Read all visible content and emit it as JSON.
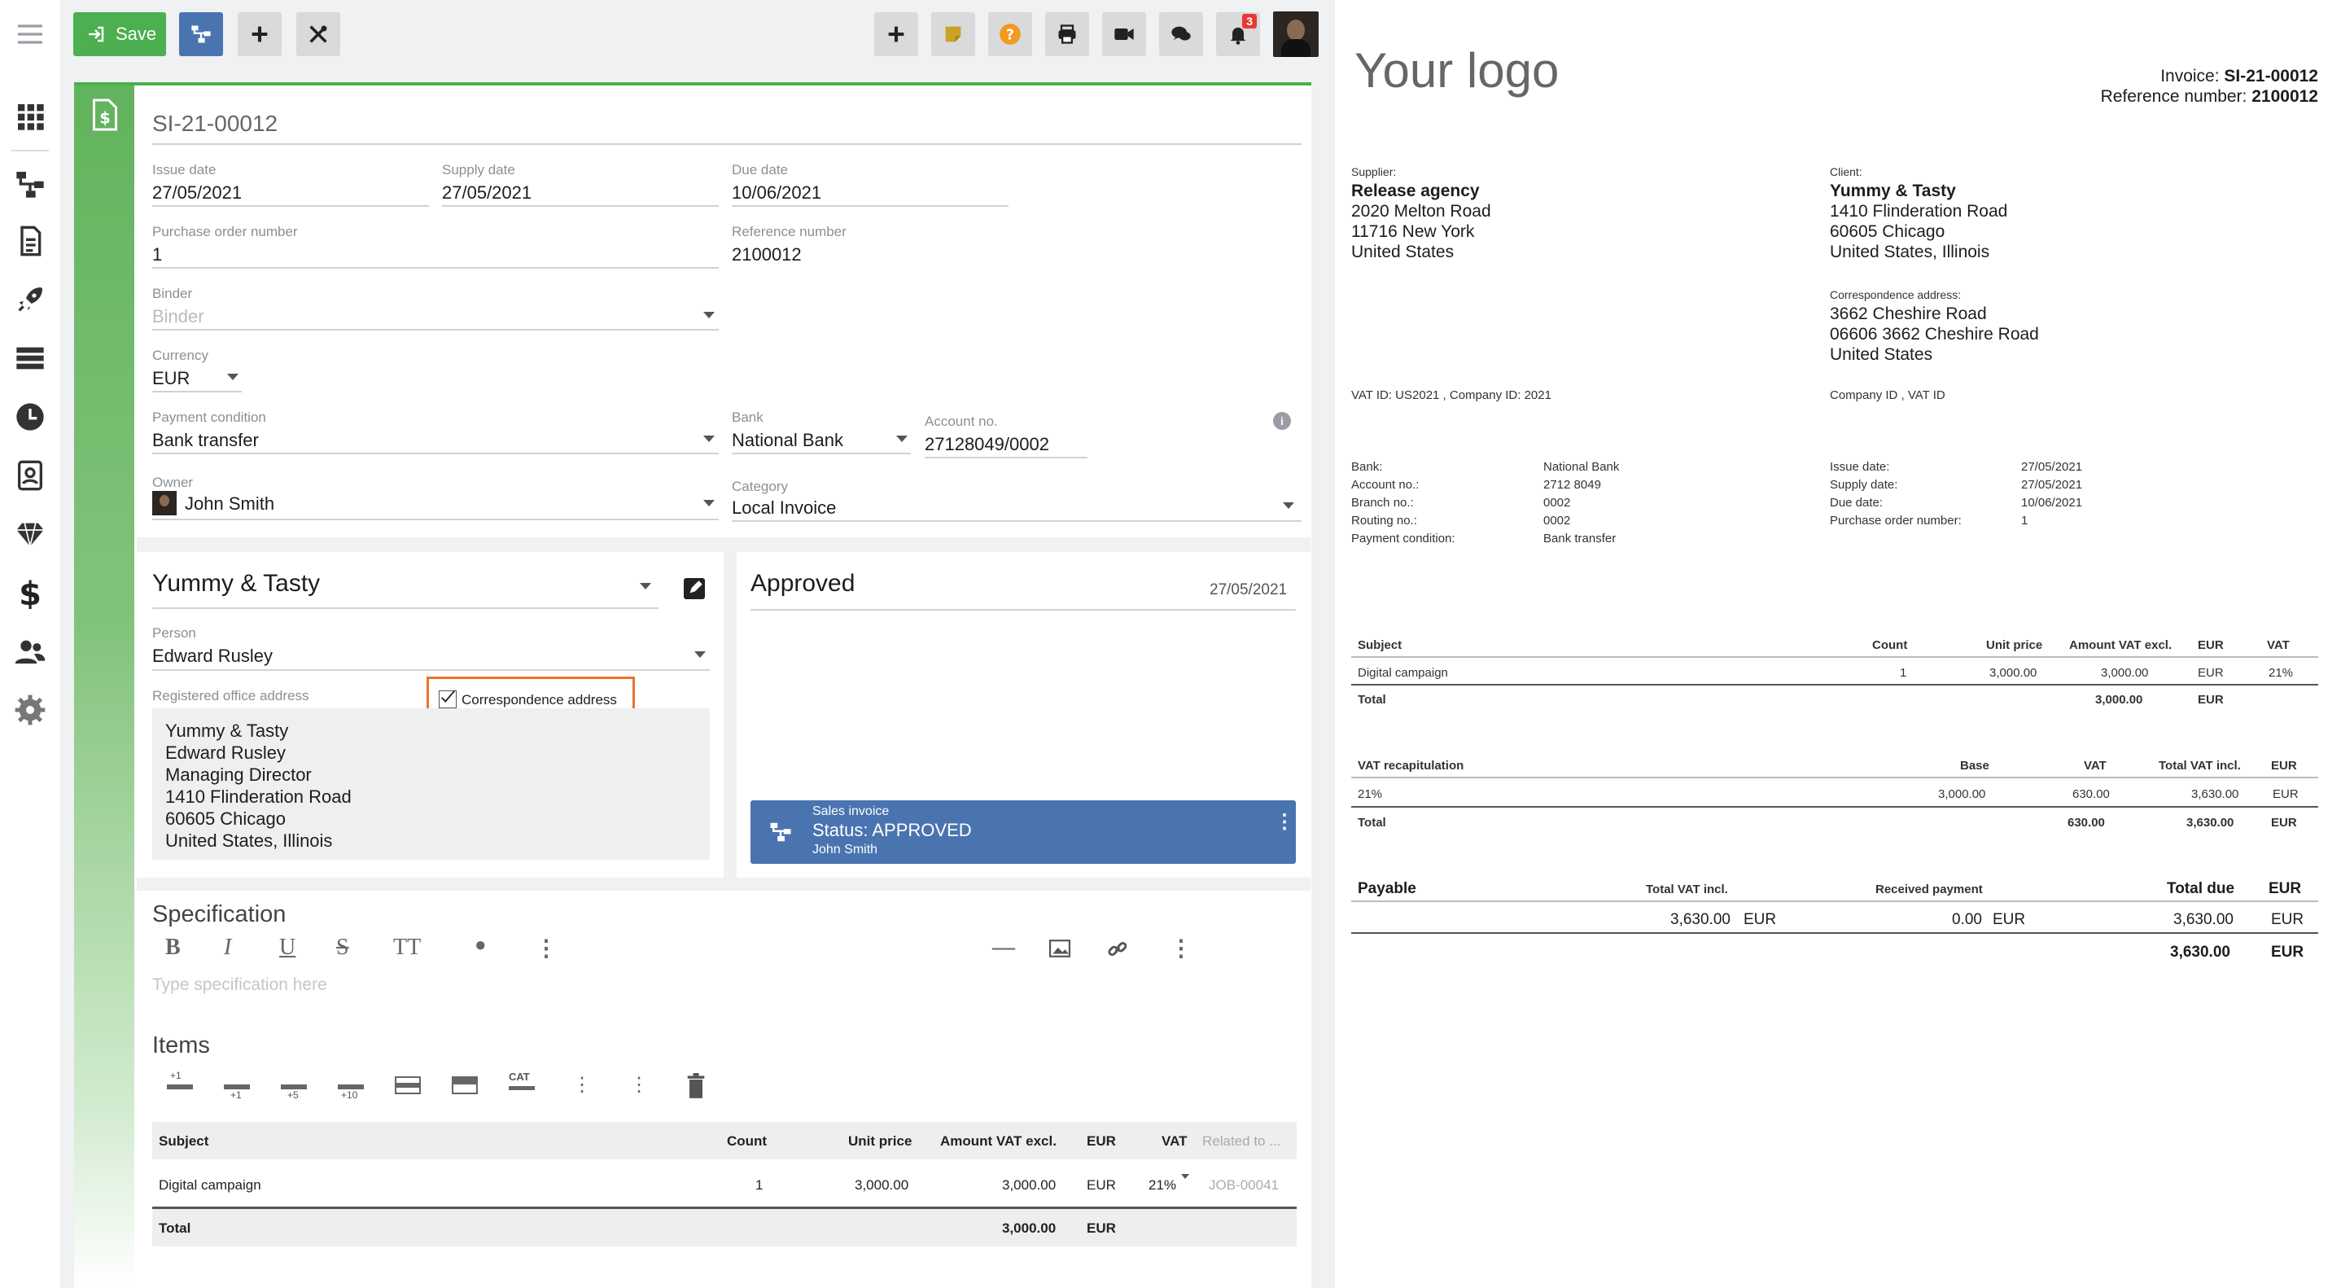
{
  "notifications_count": "3",
  "toolbar": {
    "save_label": "Save"
  },
  "doc": {
    "side_title": "SALES INVOICE",
    "number": "SI-21-00012",
    "issue_date_label": "Issue date",
    "issue_date": "27/05/2021",
    "supply_date_label": "Supply date",
    "supply_date": "27/05/2021",
    "due_date_label": "Due date",
    "due_date": "10/06/2021",
    "po_label": "Purchase order number",
    "po": "1",
    "ref_label": "Reference number",
    "ref": "2100012",
    "binder_label": "Binder",
    "binder_placeholder": "Binder",
    "currency_label": "Currency",
    "currency": "EUR",
    "payment_label": "Payment condition",
    "payment": "Bank transfer",
    "bank_label": "Bank",
    "bank": "National Bank",
    "account_label": "Account no.",
    "account": "27128049/0002",
    "owner_label": "Owner",
    "owner": "John Smith",
    "category_label": "Category",
    "category": "Local Invoice"
  },
  "client": {
    "name": "Yummy & Tasty",
    "person_label": "Person",
    "person": "Edward Rusley",
    "address_label": "Registered office address",
    "correspondence_label": "Correspondence address",
    "address_lines": [
      "Yummy & Tasty",
      "Edward Rusley",
      "Managing Director",
      "1410 Flinderation Road",
      "60605 Chicago",
      "United States, Illinois"
    ]
  },
  "status": {
    "title": "Approved",
    "date": "27/05/2021",
    "card_type": "Sales invoice",
    "card_status": "Status: APPROVED",
    "card_user": "John Smith",
    "card_color": "#4a74b0"
  },
  "spec": {
    "title": "Specification",
    "placeholder": "Type specification here"
  },
  "items": {
    "title": "Items",
    "toolbar_badges": [
      "+1",
      "+1",
      "+5",
      "+10",
      "CAT"
    ],
    "headers": [
      "Subject",
      "Count",
      "Unit price",
      "Amount VAT excl.",
      "EUR",
      "VAT",
      "Related to ..."
    ],
    "row": {
      "subject": "Digital campaign",
      "count": "1",
      "unit_price": "3,000.00",
      "amount": "3,000.00",
      "cur": "EUR",
      "vat": "21%",
      "related": "JOB-00041"
    },
    "total": {
      "label": "Total",
      "amount": "3,000.00",
      "cur": "EUR"
    }
  },
  "preview": {
    "logo": "Your logo",
    "invoice_label": "Invoice:",
    "invoice_no": "SI-21-00012",
    "ref_label": "Reference number:",
    "ref_no": "2100012",
    "supplier_label": "Supplier:",
    "supplier_name": "Release agency",
    "supplier_lines": [
      "2020 Melton Road",
      "11716 New York",
      "United States"
    ],
    "client_label": "Client:",
    "client_name": "Yummy & Tasty",
    "client_lines": [
      "1410 Flinderation Road",
      "60605 Chicago",
      "United States, Illinois"
    ],
    "corr_label": "Correspondence address:",
    "corr_lines": [
      "3662 Cheshire Road",
      "06606 3662 Cheshire Road",
      "United States"
    ],
    "vat_ids": "VAT ID: US2021 , Company ID: 2021",
    "client_ids": "Company ID , VAT ID",
    "bank_labels": [
      "Bank:",
      "Account no.:",
      "Branch no.:",
      "Routing no.:",
      "Payment condition:"
    ],
    "bank_values": [
      "National Bank",
      "2712 8049",
      "0002",
      "0002",
      "Bank transfer"
    ],
    "date_labels": [
      "Issue date:",
      "Supply date:",
      "Due date:",
      "Purchase order number:"
    ],
    "date_values": [
      "27/05/2021",
      "27/05/2021",
      "10/06/2021",
      "1"
    ],
    "items_headers": [
      "Subject",
      "Count",
      "Unit price",
      "Amount VAT excl.",
      "EUR",
      "VAT"
    ],
    "item_row": [
      "Digital campaign",
      "1",
      "3,000.00",
      "3,000.00",
      "EUR",
      "21%"
    ],
    "items_total": [
      "Total",
      "3,000.00",
      "EUR"
    ],
    "vat_headers": [
      "VAT recapitulation",
      "Base",
      "VAT",
      "Total VAT incl.",
      "EUR"
    ],
    "vat_row": [
      "21%",
      "3,000.00",
      "630.00",
      "3,630.00",
      "EUR"
    ],
    "vat_total": [
      "Total",
      "630.00",
      "3,630.00",
      "EUR"
    ],
    "pay_headers": [
      "Payable",
      "Total VAT incl.",
      "Received payment",
      "Total due",
      "EUR"
    ],
    "pay_row": [
      "3,630.00",
      "EUR",
      "0.00",
      "EUR",
      "3,630.00",
      "EUR"
    ],
    "pay_total": [
      "3,630.00",
      "EUR"
    ]
  }
}
